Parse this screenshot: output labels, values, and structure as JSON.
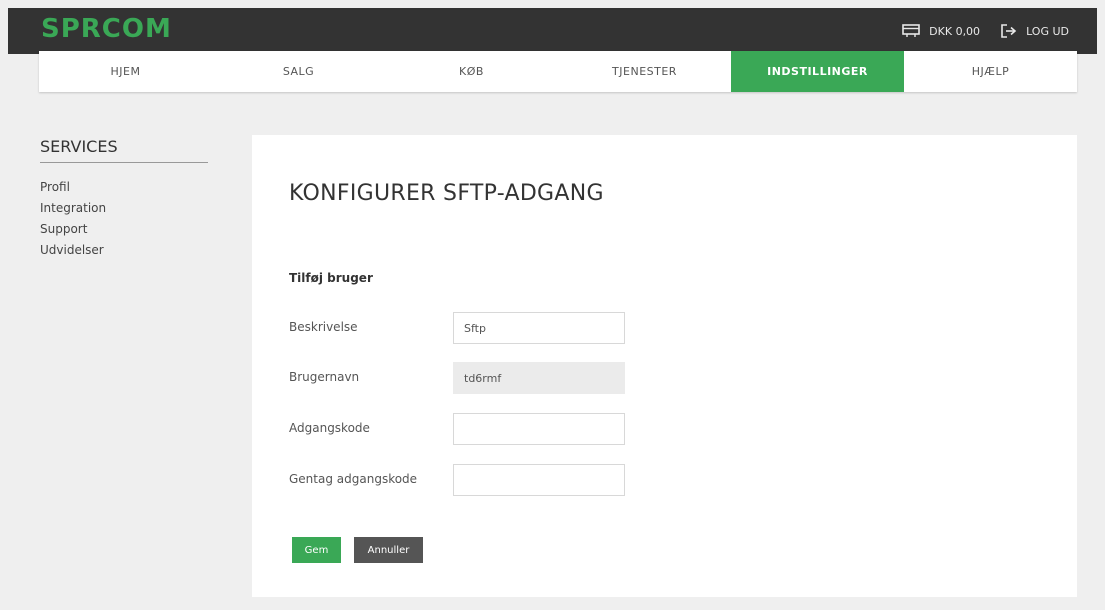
{
  "header": {
    "logo": "SPRCOM",
    "balance": "DKK 0,00",
    "logout": "LOG UD"
  },
  "nav": {
    "items": [
      "HJEM",
      "SALG",
      "KØB",
      "TJENESTER",
      "INDSTILLINGER",
      "HJÆLP"
    ],
    "active_index": 4
  },
  "sidebar": {
    "title": "SERVICES",
    "links": [
      "Profil",
      "Integration",
      "Support",
      "Udvidelser"
    ]
  },
  "main": {
    "title": "KONFIGURER SFTP-ADGANG",
    "section": "Tilføj bruger",
    "fields": [
      {
        "label": "Beskrivelse",
        "value": "Sftp",
        "readonly": false
      },
      {
        "label": "Brugernavn",
        "value": "td6rmf",
        "readonly": true
      },
      {
        "label": "Adgangskode",
        "value": "",
        "readonly": false
      },
      {
        "label": "Gentag adgangskode",
        "value": "",
        "readonly": false
      }
    ],
    "save_label": "Gem",
    "cancel_label": "Annuller"
  },
  "colors": {
    "brand_green": "#3aa856",
    "topbar": "#333333",
    "cancel_button": "#555555"
  }
}
